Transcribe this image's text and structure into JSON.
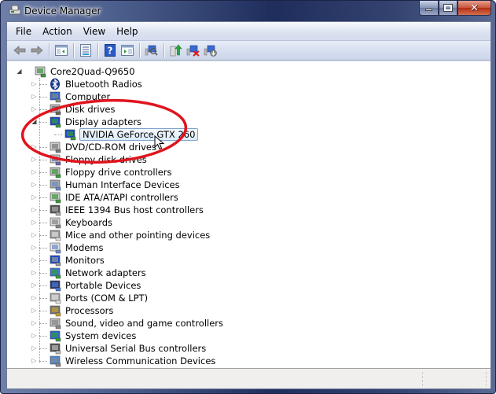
{
  "window": {
    "title": "Device Manager",
    "controls": {
      "minimize": "minimize",
      "maximize": "maximize",
      "close": "close"
    }
  },
  "menu": [
    "File",
    "Action",
    "View",
    "Help"
  ],
  "toolbar": {
    "buttons": [
      {
        "name": "back-icon"
      },
      {
        "name": "forward-icon"
      },
      {
        "name": "show-hide-console-tree-icon"
      },
      {
        "name": "properties-icon"
      },
      {
        "name": "help-icon"
      },
      {
        "name": "show-hide-action-pane-icon"
      },
      {
        "name": "scan-hardware-changes-icon"
      },
      {
        "name": "update-driver-icon"
      },
      {
        "name": "uninstall-icon"
      },
      {
        "name": "disable-device-icon"
      }
    ]
  },
  "tree": {
    "root": "Core2Quad-Q9650",
    "categories": [
      {
        "label": "Bluetooth Radios",
        "icon": "bluetooth-icon"
      },
      {
        "label": "Computer",
        "icon": "computer-icon"
      },
      {
        "label": "Disk drives",
        "icon": "disk-drive-icon"
      },
      {
        "label": "Display adapters",
        "icon": "display-adapter-icon",
        "expanded": true,
        "children": [
          {
            "label": "NVIDIA GeForce GTX 260",
            "icon": "display-adapter-icon",
            "selected": true
          }
        ]
      },
      {
        "label": "DVD/CD-ROM drives",
        "icon": "dvd-drive-icon"
      },
      {
        "label": "Floppy disk drives",
        "icon": "floppy-drive-icon"
      },
      {
        "label": "Floppy drive controllers",
        "icon": "floppy-controller-icon"
      },
      {
        "label": "Human Interface Devices",
        "icon": "hid-icon"
      },
      {
        "label": "IDE ATA/ATAPI controllers",
        "icon": "ide-controller-icon"
      },
      {
        "label": "IEEE 1394 Bus host controllers",
        "icon": "ieee1394-icon"
      },
      {
        "label": "Keyboards",
        "icon": "keyboard-icon"
      },
      {
        "label": "Mice and other pointing devices",
        "icon": "mouse-icon"
      },
      {
        "label": "Modems",
        "icon": "modem-icon"
      },
      {
        "label": "Monitors",
        "icon": "monitor-icon"
      },
      {
        "label": "Network adapters",
        "icon": "network-adapter-icon"
      },
      {
        "label": "Portable Devices",
        "icon": "portable-device-icon"
      },
      {
        "label": "Ports (COM & LPT)",
        "icon": "ports-icon"
      },
      {
        "label": "Processors",
        "icon": "processor-icon"
      },
      {
        "label": "Sound, video and game controllers",
        "icon": "sound-icon"
      },
      {
        "label": "System devices",
        "icon": "system-devices-icon"
      },
      {
        "label": "Universal Serial Bus controllers",
        "icon": "usb-icon"
      },
      {
        "label": "Wireless Communication Devices",
        "icon": "wireless-icon"
      }
    ]
  },
  "annotation": {
    "color": "#e0141e",
    "target": "NVIDIA GeForce GTX 260"
  },
  "colors": {
    "selection_border": "#7da2ce",
    "title_gradient_dark": "#1f2d5c"
  }
}
